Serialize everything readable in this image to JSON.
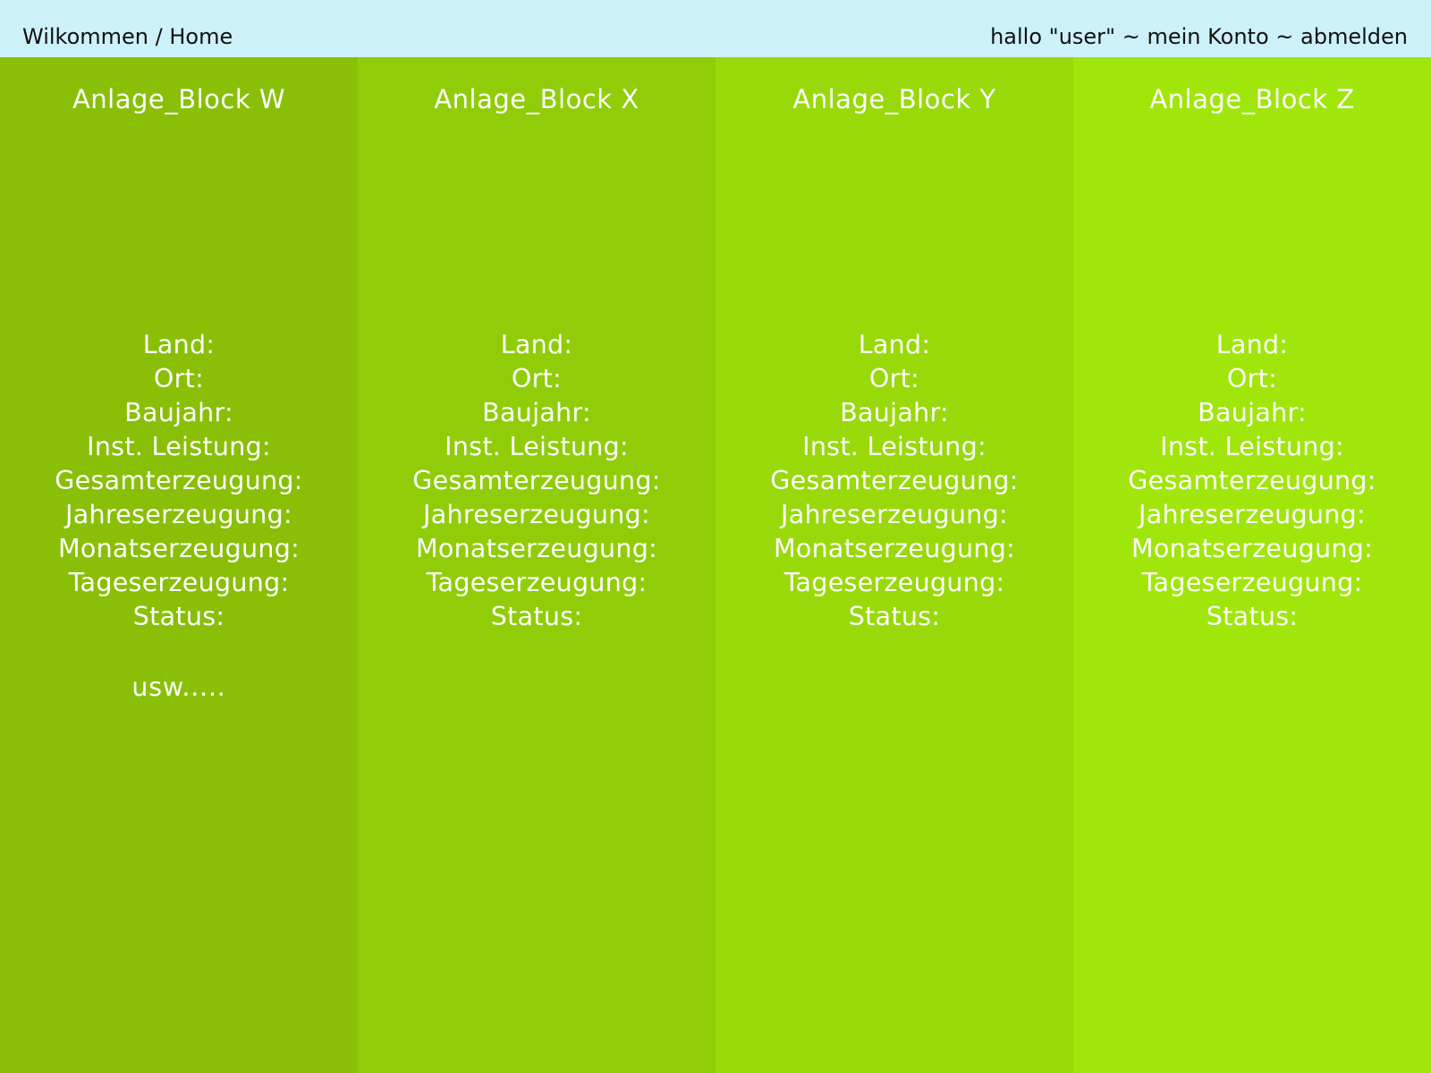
{
  "header": {
    "breadcrumb_home": "Wilkommen",
    "breadcrumb_separator": " / ",
    "breadcrumb_current": "Home",
    "greeting": "hallo \"user\"",
    "separator": " ~ ",
    "account_link": "mein Konto",
    "logout_link": "abmelden",
    "background_color": "#cdf1f8"
  },
  "columns": [
    {
      "title": "Anlage_Block W",
      "color": "#89bf06",
      "fields": [
        "Land:",
        "Ort:",
        "Baujahr:",
        "Inst. Leistung:",
        "Gesamterzeugung:",
        "Jahreserzeugung:",
        "Monatserzeugung:",
        "Tageserzeugung:",
        "Status:"
      ],
      "more": "usw....."
    },
    {
      "title": "Anlage_Block X",
      "color": "#90cd08",
      "fields": [
        "Land:",
        "Ort:",
        "Baujahr:",
        "Inst. Leistung:",
        "Gesamterzeugung:",
        "Jahreserzeugung:",
        "Monatserzeugung:",
        "Tageserzeugung:",
        "Status:"
      ]
    },
    {
      "title": "Anlage_Block Y",
      "color": "#99d909",
      "fields": [
        "Land:",
        "Ort:",
        "Baujahr:",
        "Inst. Leistung:",
        "Gesamterzeugung:",
        "Jahreserzeugung:",
        "Monatserzeugung:",
        "Tageserzeugung:",
        "Status:"
      ]
    },
    {
      "title": "Anlage_Block Z",
      "color": "#a1e60a",
      "fields": [
        "Land:",
        "Ort:",
        "Baujahr:",
        "Inst. Leistung:",
        "Gesamterzeugung:",
        "Jahreserzeugung:",
        "Monatserzeugung:",
        "Tageserzeugung:",
        "Status:"
      ]
    }
  ]
}
